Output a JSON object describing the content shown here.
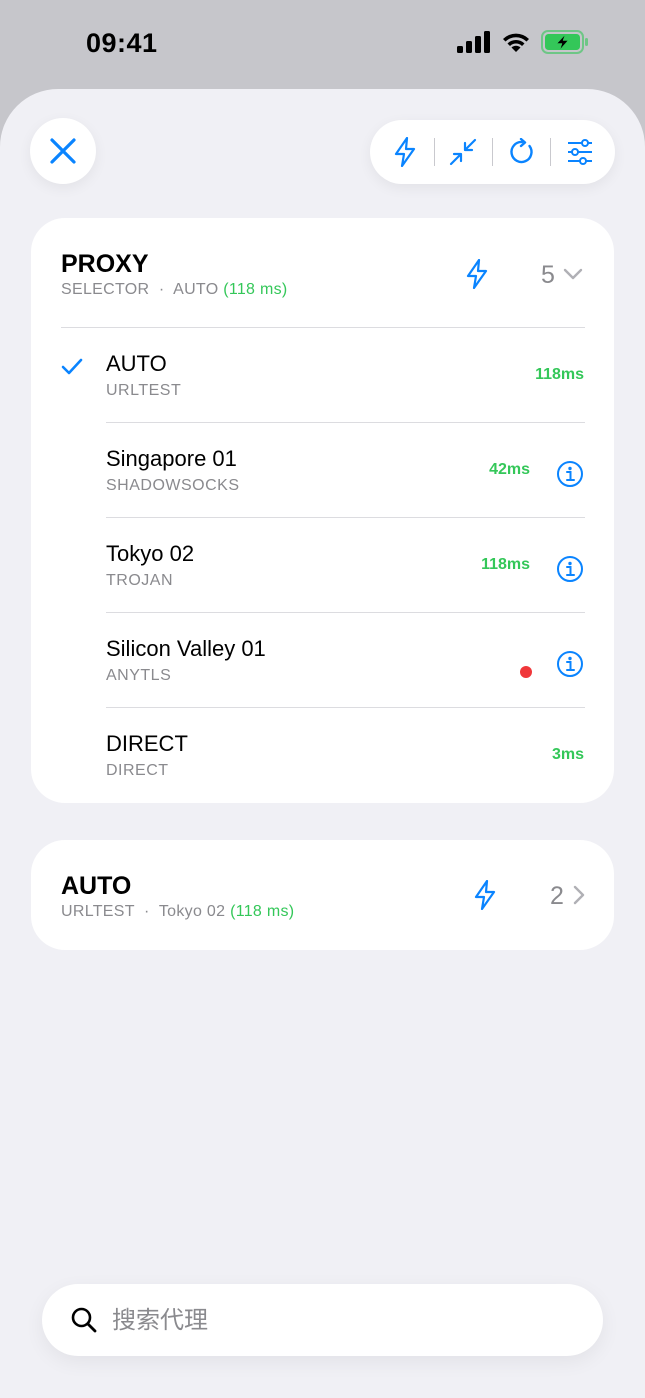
{
  "status_bar": {
    "time": "09:41"
  },
  "toolbar": {
    "buttons": [
      "bolt-icon",
      "collapse-icon",
      "refresh-icon",
      "filter-icon"
    ]
  },
  "groups": [
    {
      "title": "PROXY",
      "type": "SELECTOR",
      "selected": "AUTO",
      "latency": "(118 ms)",
      "count": "5",
      "expanded": true,
      "proxies": [
        {
          "name": "AUTO",
          "type": "URLTEST",
          "latency": "118ms",
          "selected": true,
          "info": false
        },
        {
          "name": "Singapore 01",
          "type": "SHADOWSOCKS",
          "latency": "42ms",
          "selected": false,
          "info": true
        },
        {
          "name": "Tokyo 02",
          "type": "TROJAN",
          "latency": "118ms",
          "selected": false,
          "info": true
        },
        {
          "name": "Silicon Valley 01",
          "type": "ANYTLS",
          "latency": "",
          "status": "error",
          "selected": false,
          "info": true
        },
        {
          "name": "DIRECT",
          "type": "DIRECT",
          "latency": "3ms",
          "selected": false,
          "info": false
        }
      ]
    },
    {
      "title": "AUTO",
      "type": "URLTEST",
      "selected": "Tokyo 02",
      "latency": "(118 ms)",
      "count": "2",
      "expanded": false
    }
  ],
  "search": {
    "placeholder": "搜索代理",
    "value": ""
  },
  "colors": {
    "accent": "#0a84ff",
    "latency_good": "#34c759",
    "error": "#f0373a",
    "secondary_text": "#8a8a8e"
  }
}
